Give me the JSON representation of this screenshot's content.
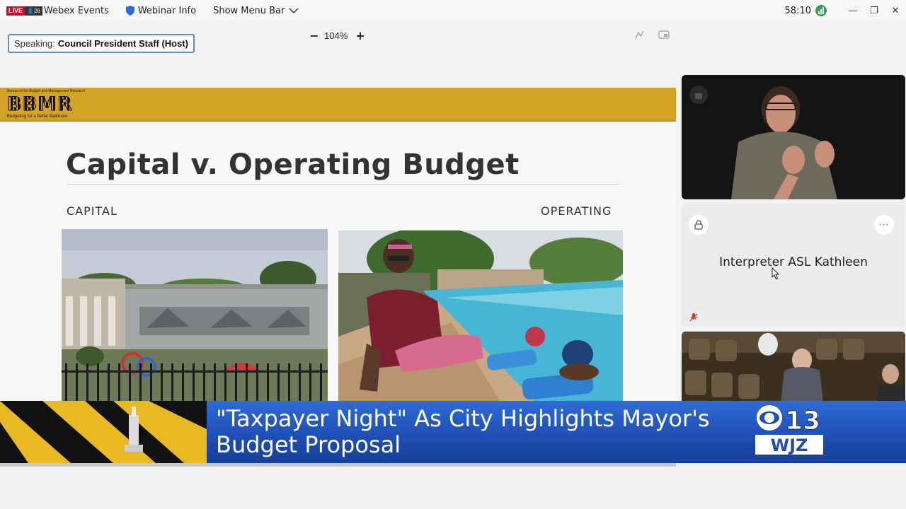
{
  "titlebar": {
    "live_label": "LIVE",
    "viewer_count": "26",
    "app_name": "Webex Events",
    "webinar_info": "Webinar Info",
    "show_menu_bar": "Show Menu Bar",
    "timer": "58:10"
  },
  "toolbar": {
    "speaking_label": "Speaking:",
    "speaking_name": "Council President Staff (Host)",
    "zoom_minus": "−",
    "zoom_level": "104%",
    "zoom_plus": "+"
  },
  "slide": {
    "logo_text": "BBMR",
    "logo_top_text": "Bureau of the Budget and Management Research",
    "logo_tagline": "Budgeting for a Better Baltimore",
    "title": "Capital v. Operating Budget",
    "left_label": "CAPITAL",
    "right_label": "OPERATING"
  },
  "panel": {
    "tile_name": "Interpreter ASL Kathleen",
    "more_glyph": "···"
  },
  "lower_third": {
    "headline_line1": "\"Taxpayer Night\" As City Highlights Mayor's",
    "headline_line2": "Budget Proposal",
    "station_channel": "13",
    "station_call": "WJZ"
  },
  "colors": {
    "banner_gold": "#d3a326",
    "lower_third_blue": "#1f4fb6",
    "live_red": "#c8102e",
    "network_green": "#3c9a57",
    "speaking_border": "#5b8fd1"
  },
  "icons": [
    "live-icon",
    "shield-icon",
    "chevron-down-icon",
    "network-icon",
    "minimize-icon",
    "restore-icon",
    "close-icon",
    "annotate-icon",
    "popout-icon",
    "lock-icon",
    "more-icon",
    "mic-muted-icon",
    "cursor-icon",
    "cbs-eye-icon"
  ]
}
